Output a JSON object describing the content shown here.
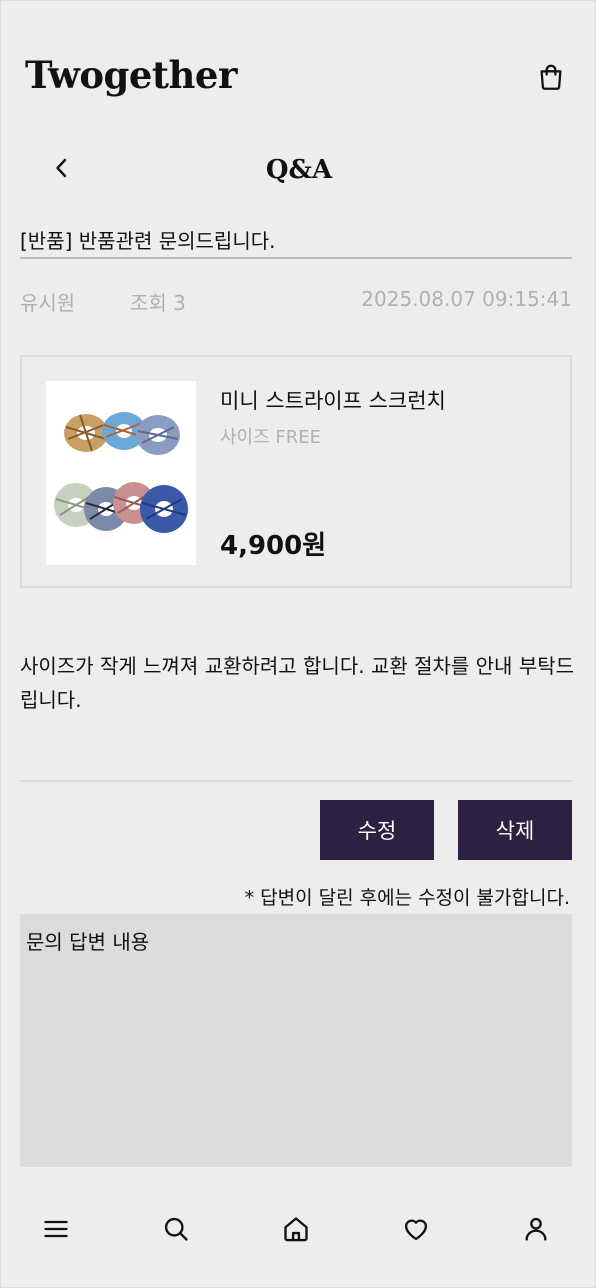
{
  "header": {
    "brand": "Twogether",
    "cart_icon": "shopping-bag-icon"
  },
  "subheader": {
    "back_icon": "chevron-left-icon",
    "title": "Q&A"
  },
  "post": {
    "title": "[반품] 반품관련 문의드립니다.",
    "author": "유시원",
    "views": "조회 3",
    "date": "2025.08.07 09:15:41",
    "body": "사이즈가 작게 느껴져 교환하려고 합니다. 교환 절차를 안내 부탁드립니다."
  },
  "product": {
    "name": "미니 스트라이프 스크런치",
    "option": "사이즈 FREE",
    "price": "4,900원",
    "image_icon": "scrunchie-product-image"
  },
  "actions": {
    "edit_label": "수정",
    "delete_label": "삭제"
  },
  "notice": "* 답변이 달린 후에는 수정이 불가합니다.",
  "answer": {
    "content": "문의 답변 내용"
  },
  "bottom_nav": {
    "items": [
      "menu-icon",
      "search-icon",
      "home-icon",
      "heart-icon",
      "user-icon"
    ]
  },
  "colors": {
    "background": "#ededee",
    "button": "#2c2143",
    "muted_text": "#b0b0b3",
    "answer_bg": "#dcdcdd"
  }
}
